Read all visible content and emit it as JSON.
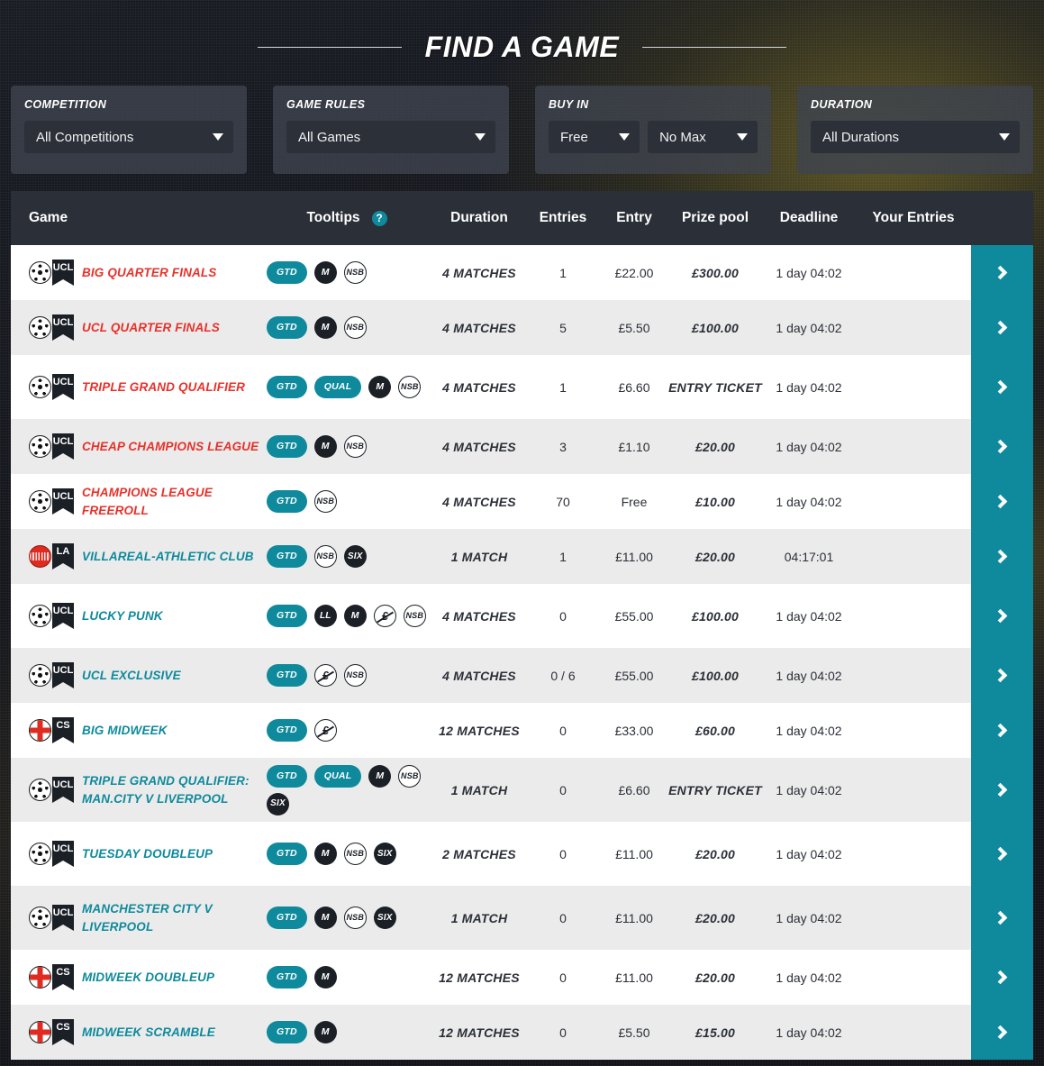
{
  "header": {
    "title": "FIND A GAME"
  },
  "filters": [
    {
      "label": "COMPETITION",
      "selects": [
        {
          "value": "All Competitions",
          "name": "competition-select"
        }
      ]
    },
    {
      "label": "GAME RULES",
      "selects": [
        {
          "value": "All Games",
          "name": "game-rules-select"
        }
      ]
    },
    {
      "label": "BUY IN",
      "selects": [
        {
          "value": "Free",
          "name": "buyin-min-select"
        },
        {
          "value": "No Max",
          "name": "buyin-max-select"
        }
      ]
    },
    {
      "label": "DURATION",
      "selects": [
        {
          "value": "All Durations",
          "name": "duration-select"
        }
      ]
    }
  ],
  "table": {
    "columns": {
      "game": "Game",
      "tooltips": "Tooltips",
      "help_icon": "?",
      "duration": "Duration",
      "entries": "Entries",
      "entry": "Entry",
      "prize_pool": "Prize pool",
      "deadline": "Deadline",
      "your_entries": "Your Entries"
    },
    "rows": [
      {
        "competition": "UCL",
        "ball": "ucl-ball",
        "name": "BIG QUARTER FINALS",
        "name_color": "red",
        "badges": [
          "GTD",
          "M",
          "NSB"
        ],
        "duration": "4 MATCHES",
        "entries": "1",
        "entry": "£22.00",
        "prize_pool": "£300.00",
        "deadline": "1 day 04:02",
        "your_entries": ""
      },
      {
        "competition": "UCL",
        "ball": "ucl-ball",
        "name": "UCL QUARTER FINALS",
        "name_color": "red",
        "badges": [
          "GTD",
          "M",
          "NSB"
        ],
        "duration": "4 MATCHES",
        "entries": "5",
        "entry": "£5.50",
        "prize_pool": "£100.00",
        "deadline": "1 day 04:02",
        "your_entries": ""
      },
      {
        "competition": "UCL",
        "ball": "ucl-ball",
        "name": "TRIPLE GRAND QUALIFIER",
        "name_color": "red",
        "badges": [
          "GTD",
          "QUAL",
          "M",
          "NSB"
        ],
        "duration": "4 MATCHES",
        "entries": "1",
        "entry": "£6.60",
        "prize_pool": "ENTRY TICKET",
        "deadline": "1 day 04:02",
        "your_entries": ""
      },
      {
        "competition": "UCL",
        "ball": "ucl-ball",
        "name": "CHEAP CHAMPIONS LEAGUE",
        "name_color": "red",
        "badges": [
          "GTD",
          "M",
          "NSB"
        ],
        "duration": "4 MATCHES",
        "entries": "3",
        "entry": "£1.10",
        "prize_pool": "£20.00",
        "deadline": "1 day 04:02",
        "your_entries": ""
      },
      {
        "competition": "UCL",
        "ball": "ucl-ball",
        "name": "CHAMPIONS LEAGUE FREEROLL",
        "name_color": "red",
        "badges": [
          "GTD",
          "NSB"
        ],
        "duration": "4 MATCHES",
        "entries": "70",
        "entry": "Free",
        "prize_pool": "£10.00",
        "deadline": "1 day 04:02",
        "your_entries": ""
      },
      {
        "competition": "LA",
        "ball": "laliga-ball",
        "name": "VILLAREAL-ATHLETIC CLUB",
        "name_color": "teal",
        "badges": [
          "GTD",
          "NSB",
          "SIX"
        ],
        "duration": "1 MATCH",
        "entries": "1",
        "entry": "£11.00",
        "prize_pool": "£20.00",
        "deadline": "04:17:01",
        "your_entries": ""
      },
      {
        "competition": "UCL",
        "ball": "ucl-ball",
        "name": "LUCKY PUNK",
        "name_color": "teal",
        "badges": [
          "GTD",
          "LL",
          "M",
          "ECROSS",
          "NSB"
        ],
        "duration": "4 MATCHES",
        "entries": "0",
        "entry": "£55.00",
        "prize_pool": "£100.00",
        "deadline": "1 day 04:02",
        "your_entries": ""
      },
      {
        "competition": "UCL",
        "ball": "ucl-ball",
        "name": "UCL EXCLUSIVE",
        "name_color": "teal",
        "badges": [
          "GTD",
          "ECROSS",
          "NSB"
        ],
        "duration": "4 MATCHES",
        "entries": "0 / 6",
        "entry": "£55.00",
        "prize_pool": "£100.00",
        "deadline": "1 day 04:02",
        "your_entries": ""
      },
      {
        "competition": "CS",
        "ball": "england-ball",
        "name": "BIG MIDWEEK",
        "name_color": "teal",
        "badges": [
          "GTD",
          "ECROSS"
        ],
        "duration": "12 MATCHES",
        "entries": "0",
        "entry": "£33.00",
        "prize_pool": "£60.00",
        "deadline": "1 day 04:02",
        "your_entries": ""
      },
      {
        "competition": "UCL",
        "ball": "ucl-ball",
        "name": "TRIPLE GRAND QUALIFIER: MAN.CITY V LIVERPOOL",
        "name_color": "teal",
        "badges": [
          "GTD",
          "QUAL",
          "M",
          "NSB",
          "SIX"
        ],
        "duration": "1 MATCH",
        "entries": "0",
        "entry": "£6.60",
        "prize_pool": "ENTRY TICKET",
        "deadline": "1 day 04:02",
        "your_entries": ""
      },
      {
        "competition": "UCL",
        "ball": "ucl-ball",
        "name": "TUESDAY DOUBLEUP",
        "name_color": "teal",
        "badges": [
          "GTD",
          "M",
          "NSB",
          "SIX"
        ],
        "duration": "2 MATCHES",
        "entries": "0",
        "entry": "£11.00",
        "prize_pool": "£20.00",
        "deadline": "1 day 04:02",
        "your_entries": ""
      },
      {
        "competition": "UCL",
        "ball": "ucl-ball",
        "name": "MANCHESTER CITY V LIVERPOOL",
        "name_color": "teal",
        "badges": [
          "GTD",
          "M",
          "NSB",
          "SIX"
        ],
        "duration": "1 MATCH",
        "entries": "0",
        "entry": "£11.00",
        "prize_pool": "£20.00",
        "deadline": "1 day 04:02",
        "your_entries": ""
      },
      {
        "competition": "CS",
        "ball": "england-ball",
        "name": "MIDWEEK DOUBLEUP",
        "name_color": "teal",
        "badges": [
          "GTD",
          "M"
        ],
        "duration": "12 MATCHES",
        "entries": "0",
        "entry": "£11.00",
        "prize_pool": "£20.00",
        "deadline": "1 day 04:02",
        "your_entries": ""
      },
      {
        "competition": "CS",
        "ball": "england-ball",
        "name": "MIDWEEK SCRAMBLE",
        "name_color": "teal",
        "badges": [
          "GTD",
          "M"
        ],
        "duration": "12 MATCHES",
        "entries": "0",
        "entry": "£5.50",
        "prize_pool": "£15.00",
        "deadline": "1 day 04:02",
        "your_entries": ""
      }
    ]
  },
  "colors": {
    "accent_teal": "#0e8a9c",
    "accent_red": "#e8312a",
    "header_dark": "#2b2f37",
    "row_alt": "#ebebeb"
  }
}
